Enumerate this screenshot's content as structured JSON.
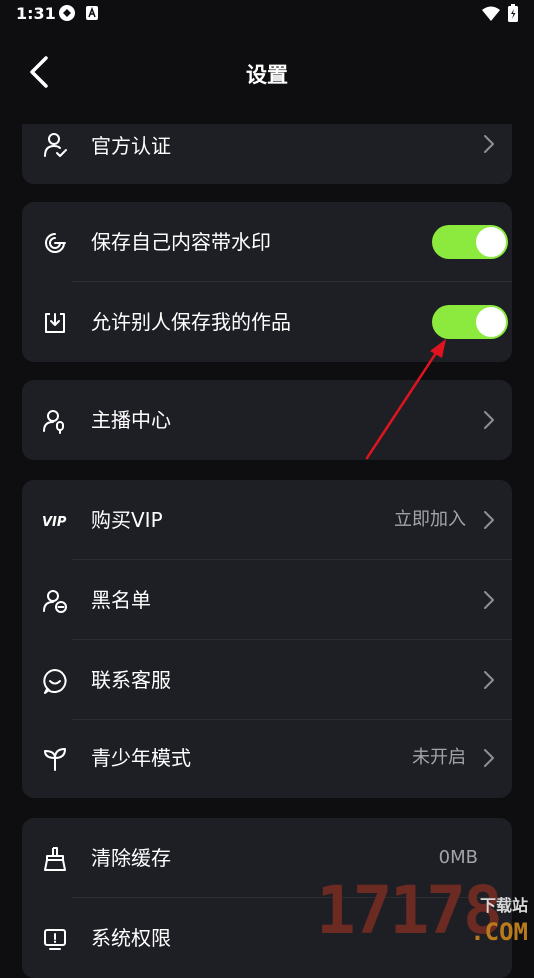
{
  "status_bar": {
    "time": "1:31"
  },
  "nav": {
    "title": "设置"
  },
  "sections": {
    "auth": {
      "label": "官方认证"
    },
    "watermark": {
      "save_watermark_label": "保存自己内容带水印",
      "save_watermark_enabled": true,
      "allow_save_label": "允许别人保存我的作品",
      "allow_save_enabled": true
    },
    "anchor": {
      "label": "主播中心"
    },
    "vip": {
      "label": "购买VIP",
      "value": "立即加入"
    },
    "blacklist": {
      "label": "黑名单"
    },
    "support": {
      "label": "联系客服"
    },
    "youth": {
      "label": "青少年模式",
      "value": "未开启"
    },
    "cache": {
      "label": "清除缓存",
      "value": "0MB"
    },
    "permissions": {
      "label": "系统权限"
    }
  },
  "watermark_logo": {
    "number": "17178",
    "site": "下载站",
    "domain": ".COM"
  },
  "colors": {
    "background": "#0e0e10",
    "card": "#1e1f25",
    "toggle_on": "#8bea3d",
    "annotation_arrow": "#e0141e"
  }
}
